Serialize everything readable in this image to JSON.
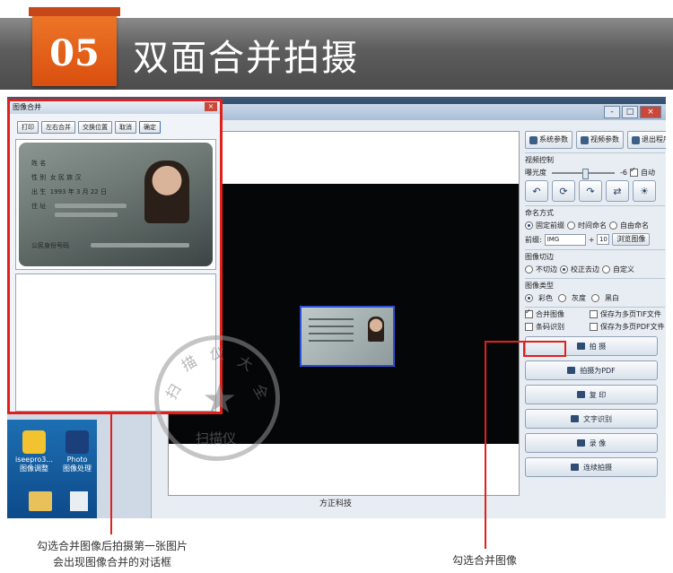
{
  "banner": {
    "step_number": "05",
    "title": "双面合并拍摄"
  },
  "dialog": {
    "title": "图像合并",
    "buttons": [
      "打印",
      "左右合并",
      "交换位置",
      "取消",
      "确定"
    ]
  },
  "id_card": {
    "rows": [
      {
        "label": "姓 名",
        "value": ""
      },
      {
        "label": "性 别",
        "value": "女  民 族 汉"
      },
      {
        "label": "出 生",
        "value": "1993 年  3 月 22 日"
      },
      {
        "label": "住 址",
        "value": ""
      },
      {
        "label": "公民身份号码",
        "value": ""
      }
    ]
  },
  "desktop": {
    "icons": [
      {
        "label": "iseepro3...",
        "sub": "图像调整",
        "color": "#f2c230"
      },
      {
        "label": "Photo",
        "sub": "图像处理",
        "color": "#1b3f7a"
      }
    ]
  },
  "app": {
    "status_text": "方正科技",
    "window_buttons": [
      "-",
      "□",
      "×"
    ],
    "top_buttons": [
      {
        "label": "系统参数",
        "icon": "gear-icon"
      },
      {
        "label": "视频参数",
        "icon": "camera-settings-icon"
      },
      {
        "label": "退出程序",
        "icon": "exit-icon"
      }
    ],
    "video_control": {
      "label": "视频控制",
      "exposure_label": "曝光度",
      "exposure_value": "-6",
      "auto_label": "自动",
      "auto_checked": true,
      "tools": [
        "rotate-left-icon",
        "rotate-icon",
        "rotate-right-icon",
        "flip-icon",
        "brightness-icon"
      ]
    },
    "naming": {
      "label": "命名方式",
      "options": [
        "固定前缀",
        "时间命名",
        "自由命名"
      ],
      "selected": 0,
      "prefix_label": "前缀:",
      "prefix_value": "IMG",
      "plus": "+",
      "number_value": "10",
      "browse_label": "浏览图像"
    },
    "crop": {
      "label": "图像切边",
      "options": [
        "不切边",
        "校正去边",
        "自定义"
      ],
      "selected": 1
    },
    "image_type": {
      "label": "图像类型",
      "options": [
        "彩色",
        "灰度",
        "黑白"
      ],
      "selected": 0
    },
    "checks": {
      "merge": "合并图像",
      "merge_checked": true,
      "barcode": "条码识别",
      "multi_tif": "保存为多页TIF文件",
      "multi_pdf": "保存为多页PDF文件"
    },
    "actions": [
      {
        "label": "拍    摄",
        "icon": "camera-icon"
      },
      {
        "label": "拍摄为PDF",
        "icon": "pdf-icon"
      },
      {
        "label": "复    印",
        "icon": "copy-icon"
      },
      {
        "label": "文字识别",
        "icon": "ocr-icon"
      },
      {
        "label": "录    像",
        "icon": "record-icon"
      },
      {
        "label": "连续拍摄",
        "icon": "burst-icon"
      }
    ]
  },
  "watermark": {
    "chars": [
      "扫",
      "描",
      "仪",
      "大",
      "全"
    ],
    "inner": "扫描仪"
  },
  "callouts": {
    "left_line1": "勾选合并图像后拍摄第一张图片",
    "left_line2": "会出现图像合并的对话框",
    "right": "勾选合并图像"
  }
}
